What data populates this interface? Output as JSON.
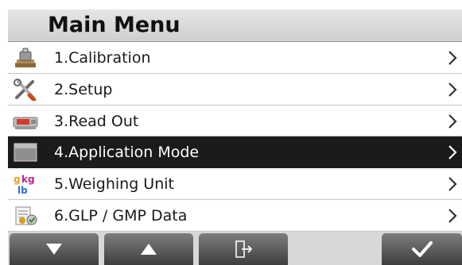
{
  "title": "Main Menu",
  "menu": {
    "items": [
      {
        "label": "1.Calibration",
        "icon": "calibration-weight-icon",
        "selected": false
      },
      {
        "label": "2.Setup",
        "icon": "tools-icon",
        "selected": false
      },
      {
        "label": "3.Read Out",
        "icon": "balance-display-icon",
        "selected": false
      },
      {
        "label": "4.Application Mode",
        "icon": "application-mode-icon",
        "selected": true
      },
      {
        "label": "5.Weighing Unit",
        "icon": "weighing-unit-icon",
        "selected": false
      },
      {
        "label": "6.GLP / GMP Data",
        "icon": "glp-data-icon",
        "selected": false
      }
    ]
  },
  "weighing_unit_icon_text": {
    "g": "g",
    "kg": "kg",
    "lb": "lb"
  },
  "softkeys": [
    {
      "name": "down-arrow-icon"
    },
    {
      "name": "up-arrow-icon"
    },
    {
      "name": "exit-icon"
    },
    {
      "name": "checkmark-icon"
    }
  ],
  "colors": {
    "selected_row": "#1b1b1b",
    "softkey": "#5a5a5a",
    "title_bar": "#dcdcdc"
  }
}
